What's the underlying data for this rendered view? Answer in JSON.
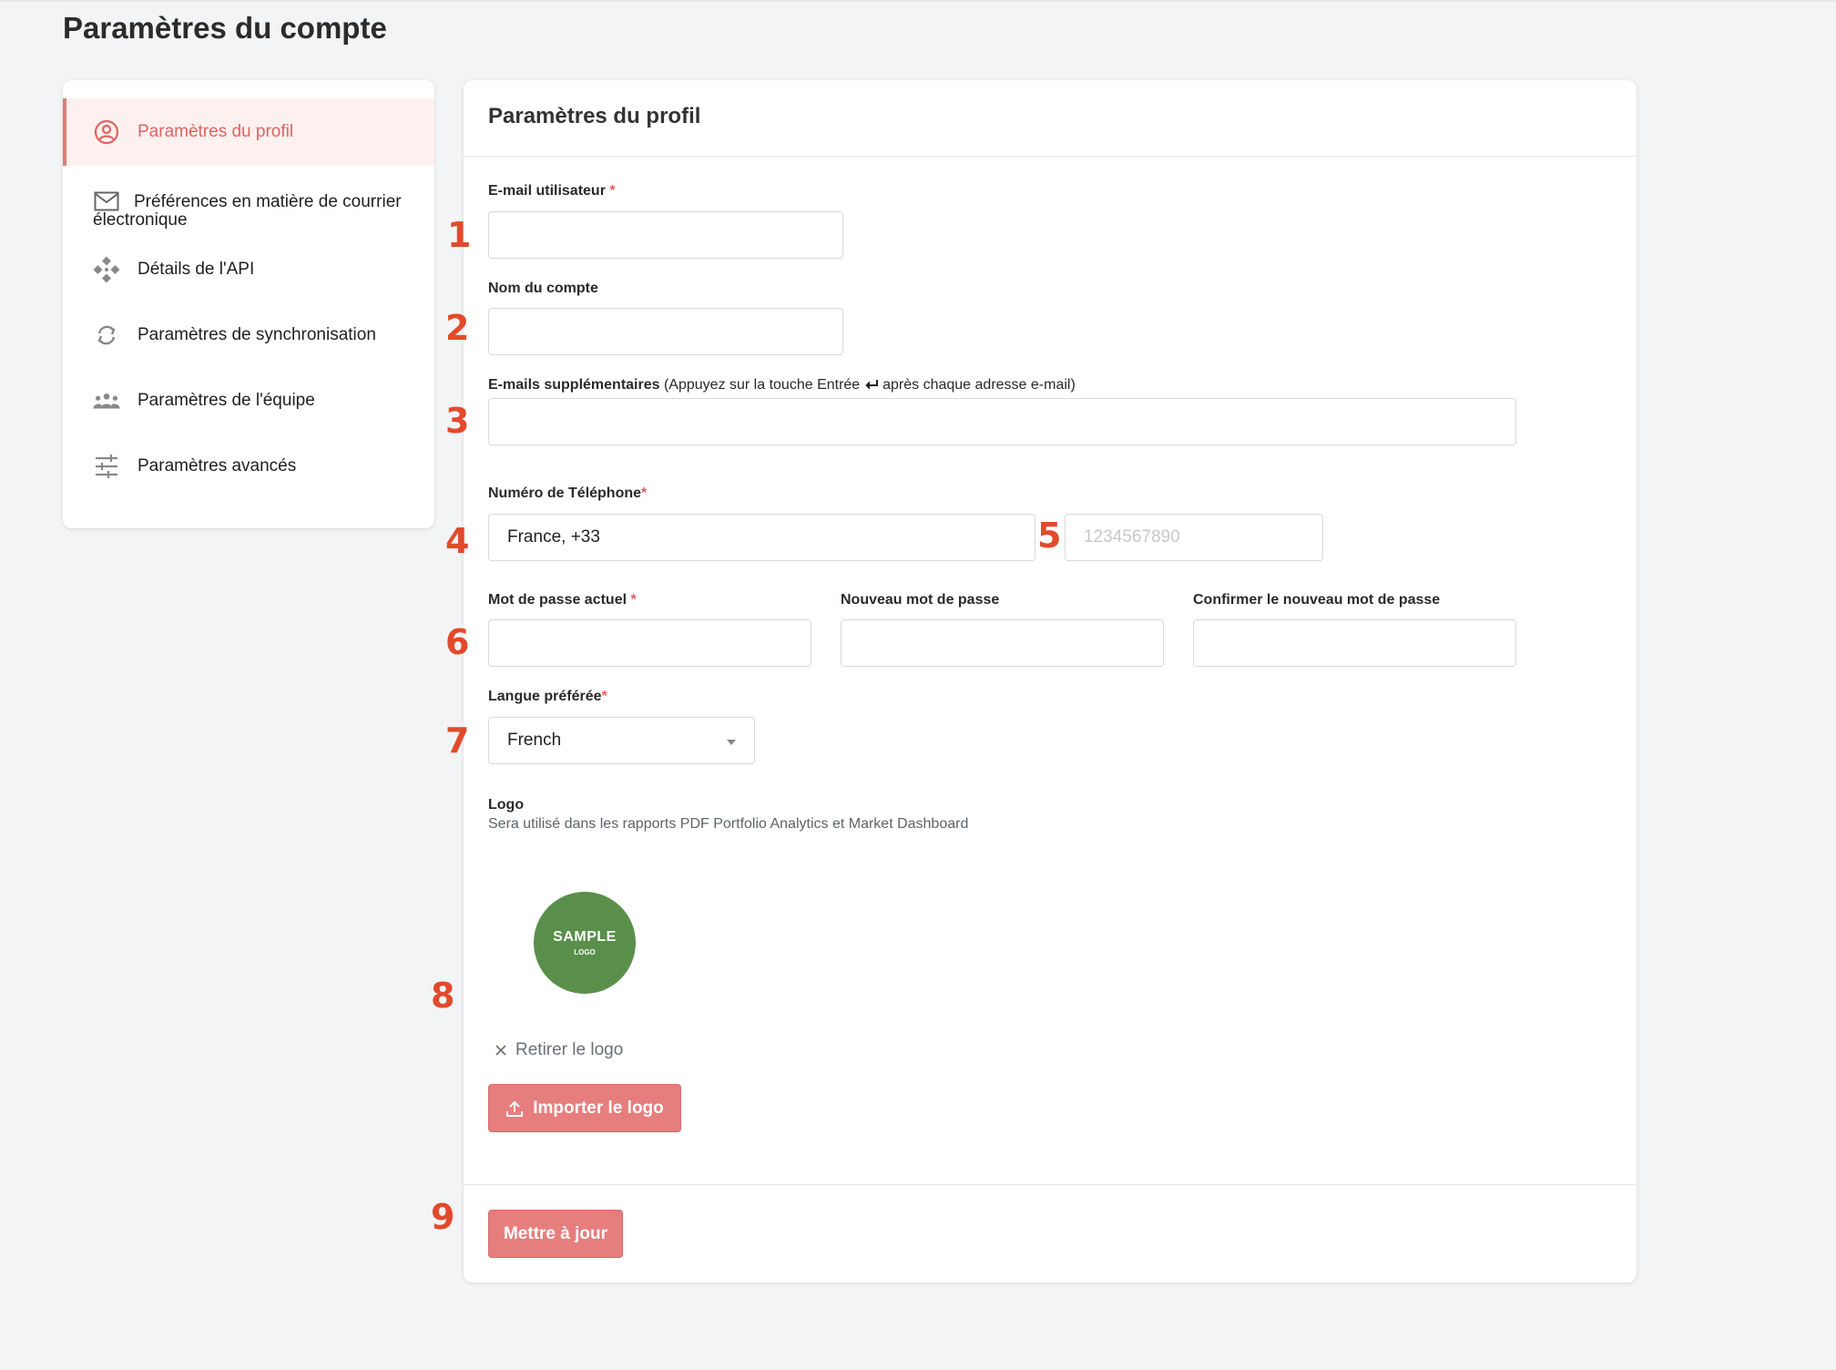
{
  "page": {
    "title": "Paramètres du compte"
  },
  "sidebar": {
    "items": [
      {
        "label": "Paramètres du profil",
        "icon": "user-circle-icon",
        "active": true
      },
      {
        "label": "Préférences en matière de courrier électronique",
        "icon": "mail-icon"
      },
      {
        "label": "Détails de l'API",
        "icon": "api-icon"
      },
      {
        "label": "Paramètres de synchronisation",
        "icon": "sync-icon"
      },
      {
        "label": "Paramètres de l'équipe",
        "icon": "team-icon"
      },
      {
        "label": "Paramètres avancés",
        "icon": "sliders-icon"
      }
    ]
  },
  "profile": {
    "title": "Paramètres du profil",
    "email": {
      "label": "E-mail utilisateur",
      "required": "*",
      "value": ""
    },
    "account_name": {
      "label": "Nom du compte",
      "value": ""
    },
    "extra_emails": {
      "label": "E-mails supplémentaires",
      "hint_before": "(Appuyez sur la touche Entrée",
      "hint_icon": "enter-key-icon",
      "hint_after": "après chaque adresse e-mail)",
      "value": ""
    },
    "phone": {
      "label": "Numéro de Téléphone",
      "required": "*",
      "country_value": "France, +33",
      "number_placeholder": "1234567890"
    },
    "current_password": {
      "label": "Mot de passe actuel",
      "required": "*"
    },
    "new_password": {
      "label": "Nouveau mot de passe"
    },
    "confirm_password": {
      "label": "Confirmer le nouveau mot de passe"
    },
    "language": {
      "label": "Langue préférée",
      "required": "*",
      "value": "French"
    },
    "logo": {
      "label": "Logo",
      "description": "Sera utilisé dans les rapports PDF Portfolio Analytics et Market Dashboard",
      "image_text_main": "SAMPLE",
      "image_text_sub": "LOGO",
      "image_color": "#5a8f4b",
      "remove_label": "Retirer le logo",
      "upload_label": "Importer le logo"
    },
    "update_label": "Mettre à jour"
  },
  "annotations": [
    "1",
    "2",
    "3",
    "4",
    "5",
    "6",
    "7",
    "8",
    "9"
  ],
  "colors": {
    "accent": "#e57e7d",
    "active_text": "#e0625f",
    "annotation": "#e24a2b"
  }
}
